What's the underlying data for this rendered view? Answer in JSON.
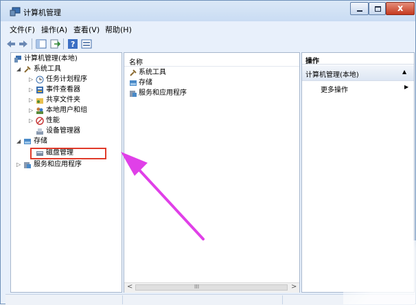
{
  "window": {
    "title": "计算机管理"
  },
  "menu": [
    {
      "label": "文件(F)"
    },
    {
      "label": "操作(A)"
    },
    {
      "label": "查看(V)"
    },
    {
      "label": "帮助(H)"
    }
  ],
  "toolbar": {
    "buttons": [
      "back-icon",
      "forward-icon",
      "show-hide-tree-icon",
      "export-icon",
      "help-icon",
      "properties-icon"
    ]
  },
  "tree": {
    "root": "计算机管理(本地)",
    "system_tools": "系统工具",
    "task_scheduler": "任务计划程序",
    "event_viewer": "事件查看器",
    "shared_folders": "共享文件夹",
    "local_users": "本地用户和组",
    "performance": "性能",
    "device_manager": "设备管理器",
    "storage": "存储",
    "disk_management": "磁盘管理",
    "services_apps": "服务和应用程序"
  },
  "content": {
    "column_name": "名称",
    "rows": [
      {
        "label": "系统工具"
      },
      {
        "label": "存储"
      },
      {
        "label": "服务和应用程序"
      }
    ],
    "scroll_grip": "III"
  },
  "actions": {
    "header": "操作",
    "section": "计算机管理(本地)",
    "more": "更多操作"
  },
  "colors": {
    "highlight": "#e03a2a",
    "arrow": "#e040e8"
  }
}
